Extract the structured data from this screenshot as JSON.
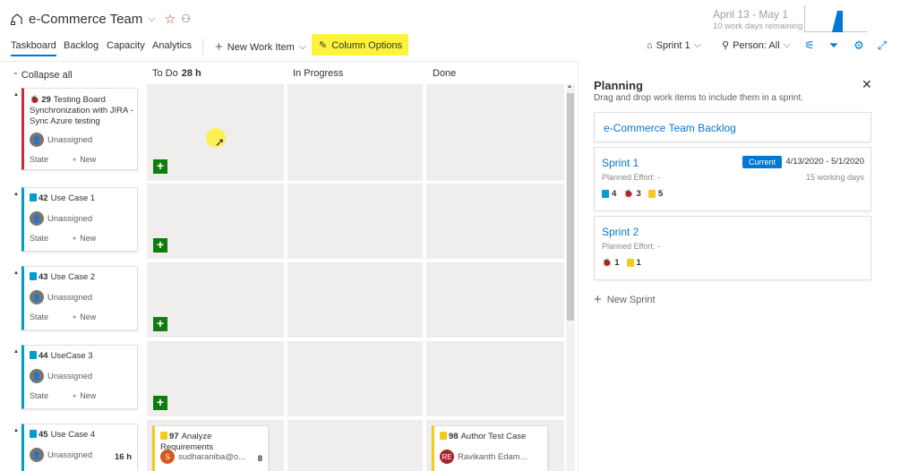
{
  "header": {
    "team_name": "e-Commerce Team",
    "sprint_dates": "April 13 - May 1",
    "sprint_remaining": "10 work days remaining"
  },
  "nav": {
    "tabs": [
      "Taskboard",
      "Backlog",
      "Capacity",
      "Analytics"
    ],
    "active_tab": "Taskboard",
    "new_work_item": "New Work Item",
    "column_options": "Column Options",
    "sprint_selector": "Sprint 1",
    "person_filter": "Person: All"
  },
  "board": {
    "collapse_all": "Collapse all",
    "columns": [
      {
        "name": "To Do",
        "hours": "28 h"
      },
      {
        "name": "In Progress",
        "hours": ""
      },
      {
        "name": "Done",
        "hours": ""
      }
    ],
    "rows": [
      {
        "id": "29",
        "title": "Testing Board Synchronization with JIRA - Sync Azure testing",
        "type": "bug",
        "assignee": "Unassigned",
        "state_label": "State",
        "state": "New"
      },
      {
        "id": "42",
        "title": "Use Case 1",
        "type": "story",
        "assignee": "Unassigned",
        "state_label": "State",
        "state": "New"
      },
      {
        "id": "43",
        "title": "Use Case 2",
        "type": "story",
        "assignee": "Unassigned",
        "state_label": "State",
        "state": "New"
      },
      {
        "id": "44",
        "title": "UseCase 3",
        "type": "story",
        "assignee": "Unassigned",
        "state_label": "State",
        "state": "New"
      },
      {
        "id": "45",
        "title": "Use Case 4",
        "type": "story",
        "assignee": "Unassigned",
        "hours": "16 h"
      }
    ],
    "tasks": [
      {
        "id": "97",
        "title": "Analyze Requirements",
        "assignee": "sudharaniba@o...",
        "remaining": "8",
        "avatar_initials": "S"
      },
      {
        "id": "98",
        "title": "Author Test Case",
        "assignee": "Ravikanth Edam...",
        "avatar_initials": "RE"
      }
    ]
  },
  "planning": {
    "title": "Planning",
    "subtitle": "Drag and drop work items to include them in a sprint.",
    "backlog_link": "e-Commerce Team Backlog",
    "sprints": [
      {
        "name": "Sprint 1",
        "badge": "Current",
        "dates": "4/13/2020 - 5/1/2020",
        "effort": "Planned Effort: -",
        "working_days": "15 working days",
        "stories": "4",
        "bugs": "3",
        "tasks": "5"
      },
      {
        "name": "Sprint 2",
        "effort": "Planned Effort: -",
        "bugs": "1",
        "tasks": "1"
      }
    ],
    "new_sprint": "New Sprint"
  },
  "colors": {
    "accent": "#0078d4",
    "story": "#009ccc",
    "bug": "#cc293d",
    "task": "#f2cb1d",
    "add_button": "#107c10",
    "highlight": "#fdf33b"
  }
}
